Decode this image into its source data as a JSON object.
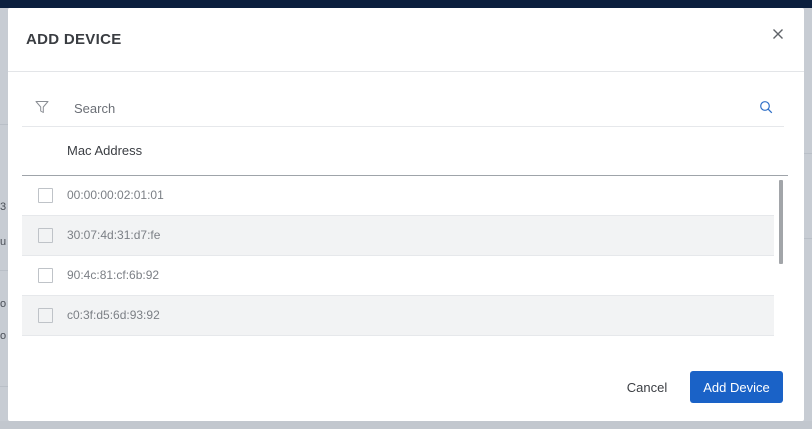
{
  "background": {
    "left_fragments": [
      "3",
      "u",
      "o",
      "o"
    ]
  },
  "modal": {
    "title": "ADD DEVICE",
    "close_icon": "close-icon"
  },
  "filter": {
    "filter_icon": "filter-icon",
    "search_placeholder": "Search",
    "search_value": "",
    "search_icon": "search-icon"
  },
  "table": {
    "columns": [
      "Mac Address"
    ],
    "rows": [
      {
        "mac": "00:00:00:02:01:01",
        "checked": false
      },
      {
        "mac": "30:07:4d:31:d7:fe",
        "checked": false
      },
      {
        "mac": "90:4c:81:cf:6b:92",
        "checked": false
      },
      {
        "mac": "c0:3f:d5:6d:93:92",
        "checked": false
      }
    ]
  },
  "footer": {
    "cancel_label": "Cancel",
    "add_label": "Add Device"
  },
  "colors": {
    "primary_button": "#1a62c7",
    "top_bar": "#0b1f3e"
  }
}
